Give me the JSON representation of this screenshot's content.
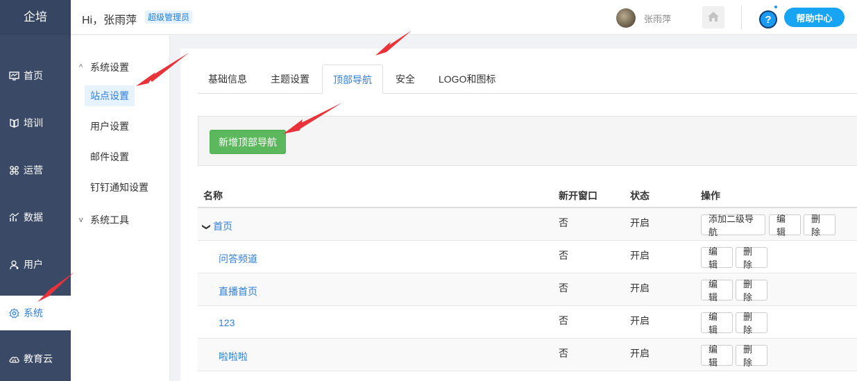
{
  "sidebar": {
    "brand": "企培",
    "items": [
      {
        "label": "首页",
        "icon": "dashboard-icon"
      },
      {
        "label": "培训",
        "icon": "training-icon"
      },
      {
        "label": "运营",
        "icon": "operation-icon"
      },
      {
        "label": "数据",
        "icon": "chart-icon"
      },
      {
        "label": "用户",
        "icon": "user-icon"
      },
      {
        "label": "系统",
        "icon": "gear-icon",
        "active": true
      },
      {
        "label": "教育云",
        "icon": "cloud-icon"
      }
    ]
  },
  "header": {
    "greeting": "Hi，张雨萍",
    "role_badge": "超级管理员",
    "username": "张雨萍",
    "help_label": "帮助中心",
    "help_glyph": "?"
  },
  "submenu": {
    "group1": "系统设置",
    "group1_caret": "^",
    "items": [
      "站点设置",
      "用户设置",
      "邮件设置",
      "钉钉通知设置"
    ],
    "group2": "系统工具",
    "group2_caret": "v"
  },
  "tabs": [
    "基础信息",
    "主题设置",
    "顶部导航",
    "安全",
    "LOGO和图标"
  ],
  "active_tab": "顶部导航",
  "toolbar": {
    "add_label": "新增顶部导航"
  },
  "table": {
    "headers": [
      "名称",
      "新开窗口",
      "状态",
      "操作"
    ],
    "rows": [
      {
        "name": "首页",
        "new_window": "否",
        "status": "开启",
        "expand": "❯",
        "actions": [
          "添加二级导航",
          "编辑",
          "删除"
        ]
      },
      {
        "name": "问答频道",
        "new_window": "否",
        "status": "开启",
        "actions": [
          "编辑",
          "删除"
        ]
      },
      {
        "name": "直播首页",
        "new_window": "否",
        "status": "开启",
        "actions": [
          "编辑",
          "删除"
        ]
      },
      {
        "name": "123",
        "new_window": "否",
        "status": "开启",
        "actions": [
          "编辑",
          "删除"
        ]
      },
      {
        "name": "啦啦啦",
        "new_window": "否",
        "status": "开启",
        "actions": [
          "编辑",
          "删除"
        ]
      }
    ]
  },
  "colors": {
    "sidebar_bg": "#3a4a66",
    "accent": "#2f7fd8",
    "success": "#5cb85c",
    "annotation_arrow": "#e8333a"
  }
}
